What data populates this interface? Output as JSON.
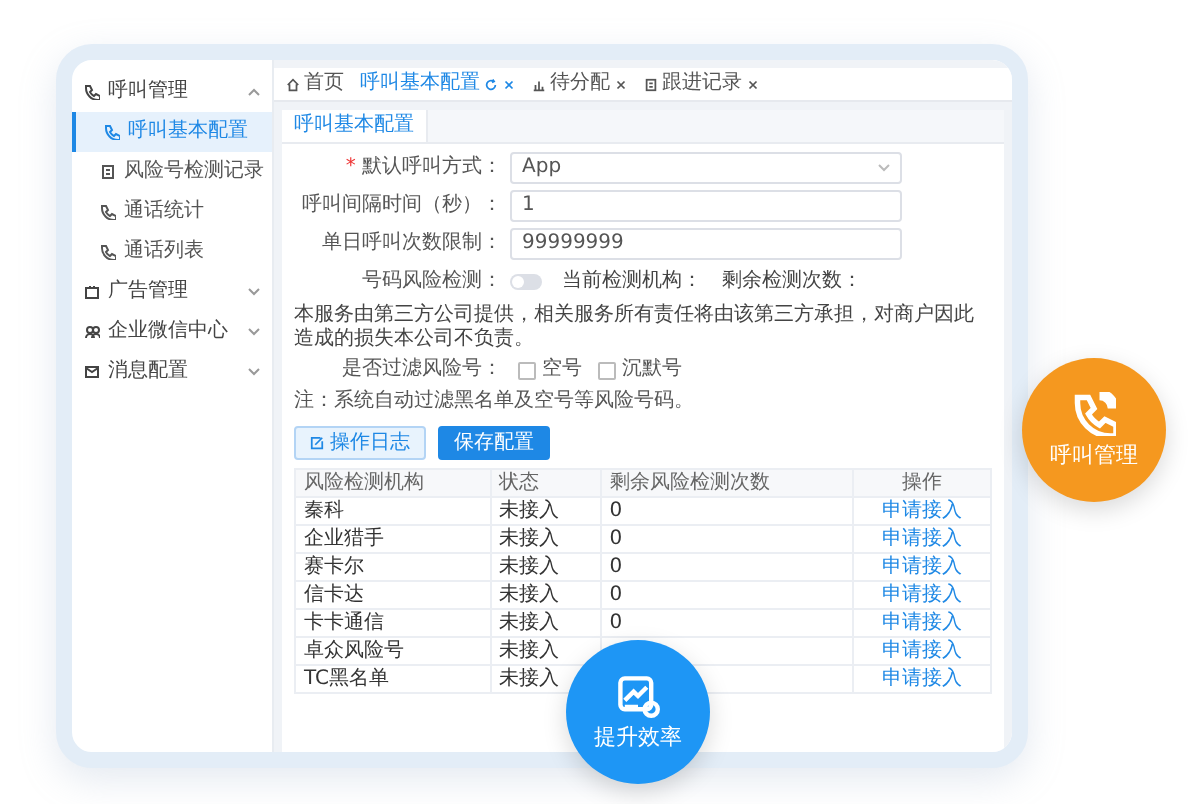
{
  "sidebar": {
    "items": [
      {
        "label": "呼叫管理",
        "expanded": true,
        "children": [
          {
            "label": "呼叫基本配置",
            "selected": true
          },
          {
            "label": "风险号检测记录",
            "selected": false
          },
          {
            "label": "通话统计",
            "selected": false
          },
          {
            "label": "通话列表",
            "selected": false
          }
        ]
      },
      {
        "label": "广告管理",
        "expanded": false
      },
      {
        "label": "企业微信中心",
        "expanded": false
      },
      {
        "label": "消息配置",
        "expanded": false
      }
    ]
  },
  "tabs": [
    {
      "label": "首页",
      "selected": false,
      "kind": "home"
    },
    {
      "label": "呼叫基本配置",
      "selected": true,
      "kind": "page"
    },
    {
      "label": "待分配",
      "selected": false,
      "kind": "page"
    },
    {
      "label": "跟进记录",
      "selected": false,
      "kind": "page"
    }
  ],
  "subtab": {
    "label": "呼叫基本配置"
  },
  "form": {
    "fields": [
      {
        "label": "默认呼叫方式：",
        "required_mark": "*",
        "kind": "select",
        "value": "App"
      },
      {
        "label": "呼叫间隔时间（秒）：",
        "kind": "input",
        "value": "1"
      },
      {
        "label": "单日呼叫次数限制：",
        "kind": "input",
        "value": "99999999"
      }
    ],
    "risk_check": {
      "label": "号码风险检测：",
      "on": false,
      "agency_label": "当前检测机构：",
      "remaining_label": "剩余检测次数："
    },
    "disclaimer": "本服务由第三方公司提供，相关服务所有责任将由该第三方承担，对商户因此造成的损失本公司不负责。",
    "filter": {
      "label": "是否过滤风险号：",
      "options": [
        {
          "label": "空号",
          "checked": false
        },
        {
          "label": "沉默号",
          "checked": false
        }
      ],
      "note": "注：系统自动过滤黑名单及空号等风险号码。"
    }
  },
  "buttons": [
    {
      "label": "操作日志",
      "kind": "secondary"
    },
    {
      "label": "保存配置",
      "kind": "primary"
    }
  ],
  "table": {
    "columns": [
      "风险检测机构",
      "状态",
      "剩余风险检测次数",
      "操作"
    ],
    "rows": [
      {
        "agency": "秦科",
        "status": "未接入",
        "remaining": "0",
        "action": "申请接入"
      },
      {
        "agency": "企业猎手",
        "status": "未接入",
        "remaining": "0",
        "action": "申请接入"
      },
      {
        "agency": "赛卡尔",
        "status": "未接入",
        "remaining": "0",
        "action": "申请接入"
      },
      {
        "agency": "信卡达",
        "status": "未接入",
        "remaining": "0",
        "action": "申请接入"
      },
      {
        "agency": "卡卡通信",
        "status": "未接入",
        "remaining": "0",
        "action": "申请接入"
      },
      {
        "agency": "卓众风险号",
        "status": "未接入",
        "action": "申请接入"
      },
      {
        "agency": "TC黑名单",
        "status": "未接入",
        "action": "申请接入"
      }
    ]
  },
  "badges": [
    {
      "label": "呼叫管理",
      "kind": "phone",
      "color": "#f5981f"
    },
    {
      "label": "提升效率",
      "kind": "chart",
      "color": "#1e96f5"
    }
  ]
}
